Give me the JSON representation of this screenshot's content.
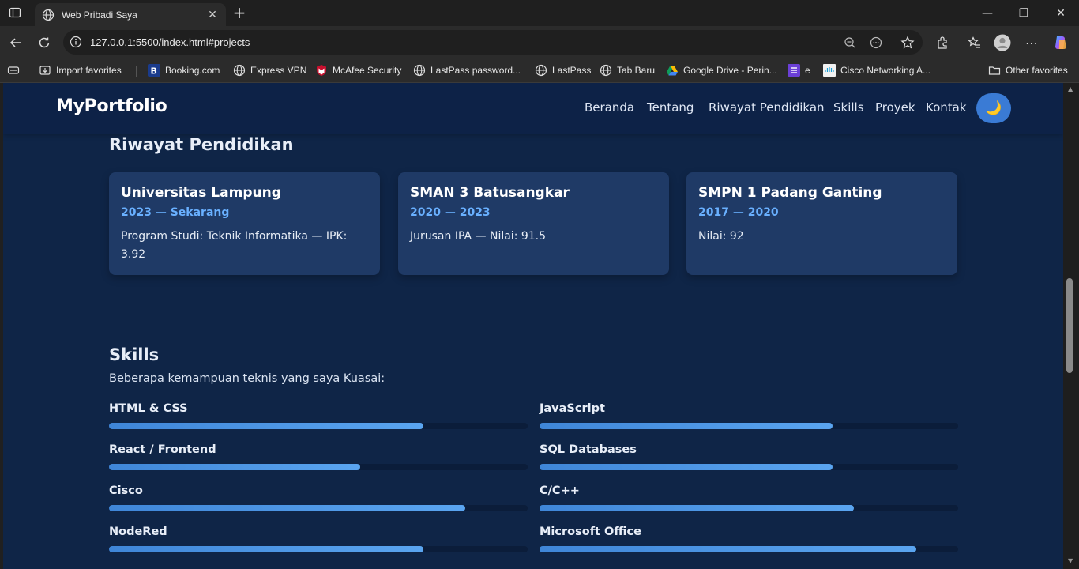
{
  "browser": {
    "tab_title": "Web Pribadi Saya",
    "url": "127.0.0.1:5500/index.html#projects",
    "bookmarks": [
      {
        "label": "Import favorites",
        "icon": "import-icon"
      },
      {
        "label": "Booking.com",
        "icon": "booking-icon"
      },
      {
        "label": "Express VPN",
        "icon": "globe-icon"
      },
      {
        "label": "McAfee Security",
        "icon": "mcafee-icon"
      },
      {
        "label": "LastPass password...",
        "icon": "globe-icon"
      },
      {
        "label": "LastPass",
        "icon": "globe-icon"
      },
      {
        "label": "Tab Baru",
        "icon": "globe-icon"
      },
      {
        "label": "Google Drive - Perin...",
        "icon": "google-drive-icon"
      },
      {
        "label": "e",
        "icon": "purple-app-icon"
      },
      {
        "label": "Cisco Networking A...",
        "icon": "cisco-icon"
      }
    ],
    "other_favorites": "Other favorites"
  },
  "site": {
    "logo": "MyPortfolio",
    "nav": [
      "Beranda",
      "Tentang",
      "Riwayat Pendidikan",
      "Skills",
      "Proyek",
      "Kontak"
    ],
    "theme_toggle_icon": "🌙"
  },
  "education": {
    "title": "Riwayat Pendidikan",
    "items": [
      {
        "school": "Universitas Lampung",
        "years": "2023 — Sekarang",
        "desc": "Program Studi: Teknik Informatika — IPK: 3.92"
      },
      {
        "school": "SMAN 3 Batusangkar",
        "years": "2020 — 2023",
        "desc": "Jurusan IPA — Nilai: 91.5"
      },
      {
        "school": "SMPN 1 Padang Ganting",
        "years": "2017 — 2020",
        "desc": "Nilai: 92"
      }
    ]
  },
  "skills": {
    "title": "Skills",
    "subtitle": "Beberapa kemampuan teknis yang saya Kuasai:",
    "items": [
      {
        "name": "HTML & CSS",
        "level": 0.75
      },
      {
        "name": "JavaScript",
        "level": 0.7
      },
      {
        "name": "React / Frontend",
        "level": 0.6
      },
      {
        "name": "SQL Databases",
        "level": 0.7
      },
      {
        "name": "Cisco",
        "level": 0.85
      },
      {
        "name": "C/C++",
        "level": 0.75
      },
      {
        "name": "NodeRed",
        "level": 0.75
      },
      {
        "name": "Microsoft Office",
        "level": 0.9
      }
    ]
  },
  "colors": {
    "page_bg": "#0f2547",
    "card_bg": "#1f3a66",
    "accent": "#3a7bd5",
    "years_text": "#69b0ff"
  }
}
